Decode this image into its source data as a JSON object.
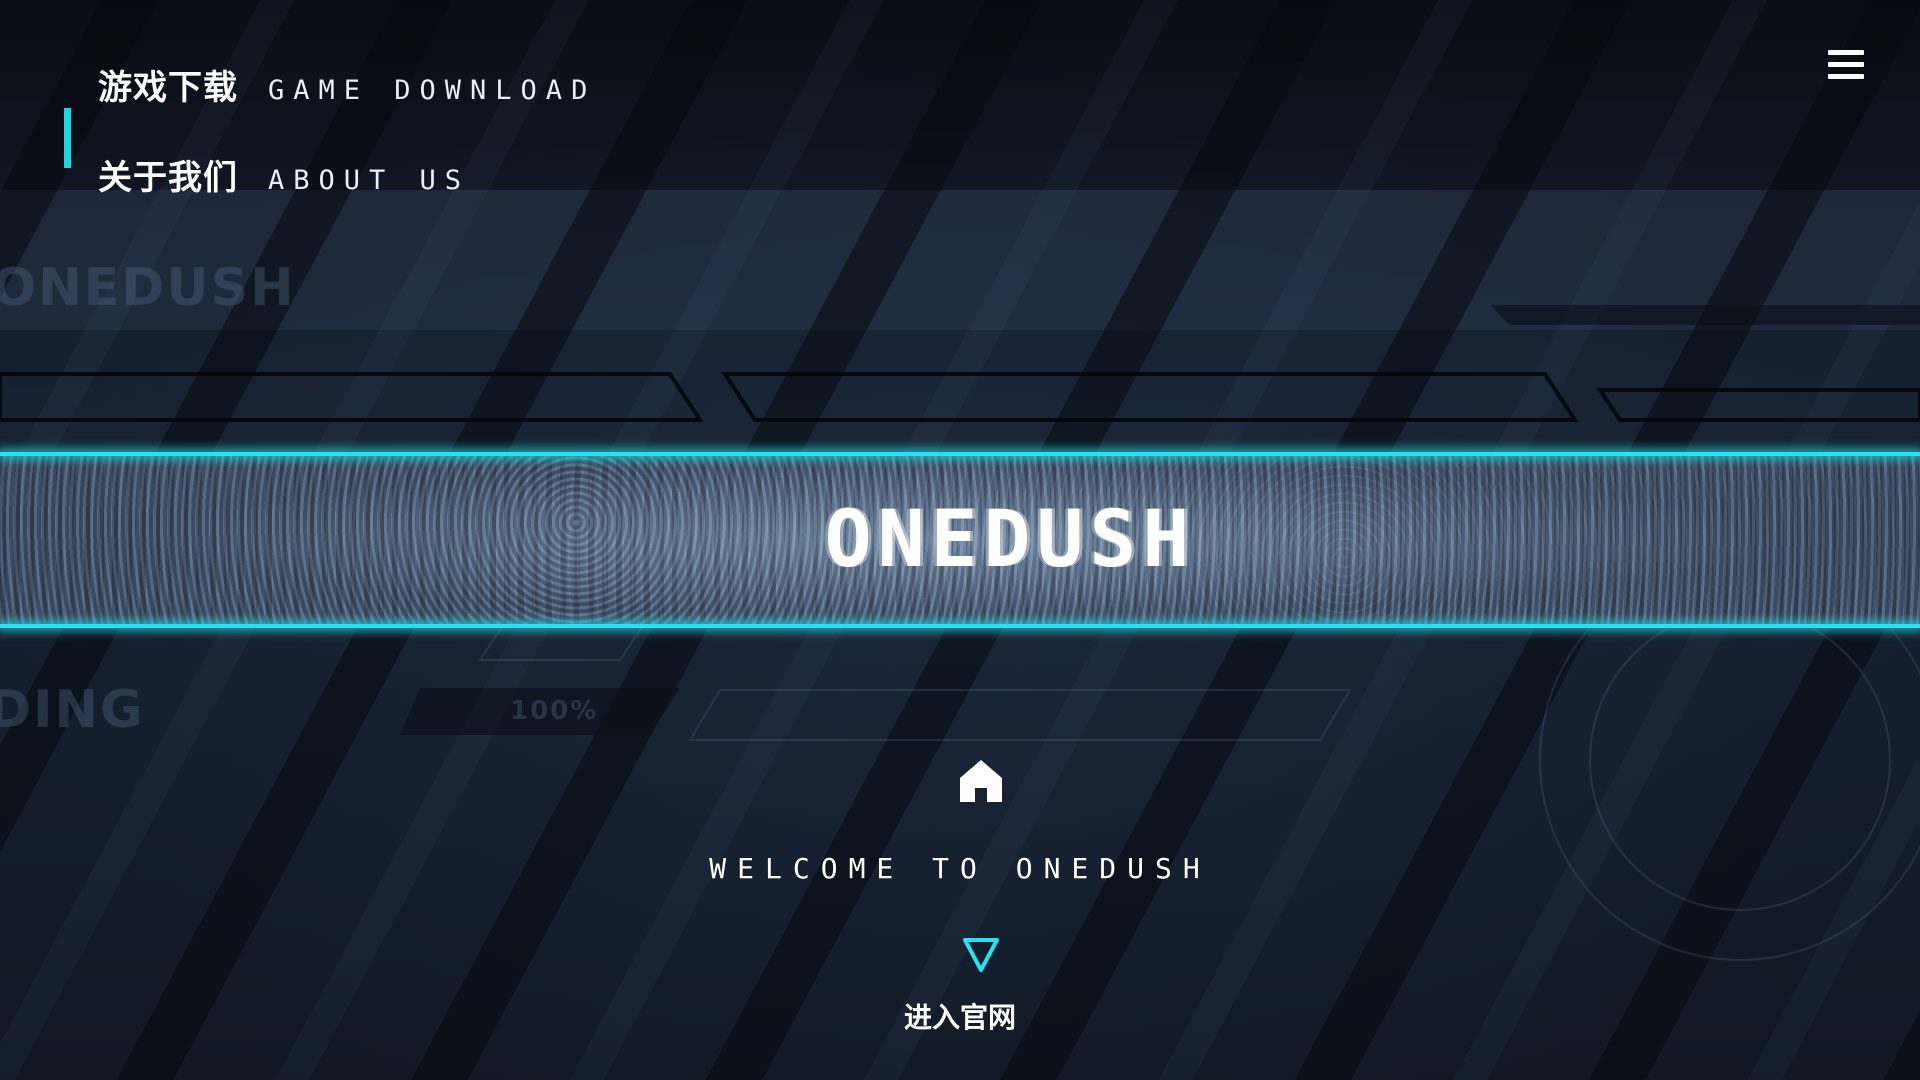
{
  "nav": {
    "items": [
      {
        "cn": "游戏下载",
        "en": "GAME DOWNLOAD"
      },
      {
        "cn": "关于我们",
        "en": "ABOUT US"
      }
    ],
    "menu_icon": "hamburger-menu-icon"
  },
  "background_text": {
    "brand_ghost": "ONEDUSH",
    "loading_ghost": "DING",
    "percent_ghost": "100%"
  },
  "banner": {
    "logo": "ONEDUSH"
  },
  "hero": {
    "home_icon": "home-icon",
    "welcome": "WELCOME TO ONEDUSH",
    "enter_icon": "down-triangle-icon",
    "enter_label": "进入官网"
  },
  "colors": {
    "accent": "#22e3ef",
    "background": "#121925",
    "text": "#ffffff"
  }
}
